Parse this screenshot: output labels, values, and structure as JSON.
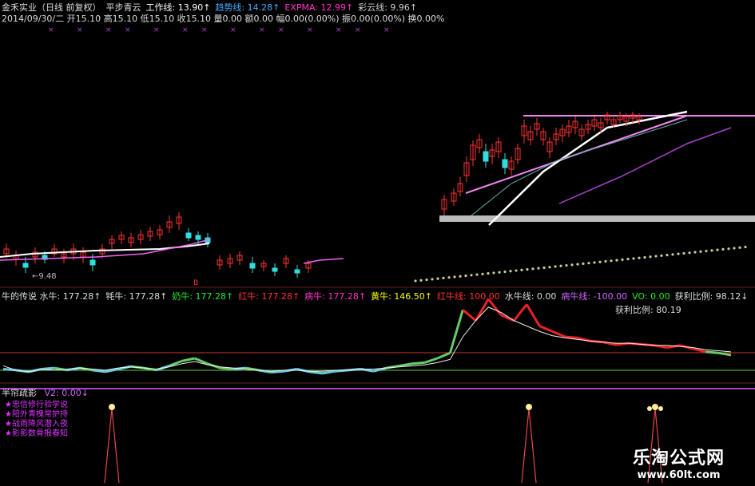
{
  "header": {
    "title_line": [
      {
        "text": "金禾实业（日线 前复权）",
        "color": "#dddddd"
      },
      {
        "text": "平步青云",
        "color": "#dddddd"
      },
      {
        "text": "工作线: 13.90↑",
        "color": "#ffffff"
      },
      {
        "text": "趋势线: 14.28↑",
        "color": "#44aaff"
      },
      {
        "text": "EXPMA: 12.99↑",
        "color": "#ff33cc"
      },
      {
        "text": "彩云线: 9.96↑",
        "color": "#cccccc"
      }
    ],
    "info_line": "2014/09/30/二 开15.10 高15.10 低15.10 收15.10 量0.00 额0.00 幅0.00(0.00%) 振0.00(0.00%) 换0.00%"
  },
  "main_chart": {
    "low_label": "←9.48",
    "marker_text": "B"
  },
  "indicator1": {
    "values": [
      {
        "text": "牛的传说 水牛: 177.28↑",
        "color": "#dddddd"
      },
      {
        "text": "牦牛: 177.28↑",
        "color": "#dddddd"
      },
      {
        "text": "奶牛: 177.28↑",
        "color": "#22ee22"
      },
      {
        "text": "红牛: 177.28↑",
        "color": "#ff3333"
      },
      {
        "text": "病牛: 177.28↑",
        "color": "#ff33cc"
      },
      {
        "text": "黄牛: 146.50↑",
        "color": "#ffff00"
      },
      {
        "text": "红牛线: 100.00",
        "color": "#ff3333"
      },
      {
        "text": "水牛线: 0.00",
        "color": "#dddddd"
      },
      {
        "text": "病牛线: -100.00",
        "color": "#cc66ff"
      },
      {
        "text": "VO: 0.00",
        "color": "#22ee22"
      },
      {
        "text": "获利比例: 98.12↓",
        "color": "#dddddd"
      }
    ],
    "ratio2": "获利比例: 80.19"
  },
  "indicator2": {
    "label": "半帘疏影",
    "v2": "V2: 0.00↓",
    "notes": [
      "★忠信修行验学说",
      "★阳外青槐常护持",
      "★战雨降风潜入夜",
      "★影影数骨报春知"
    ]
  },
  "watermark": {
    "line1": "乐淘公式网",
    "line2": "www.60lt.com"
  },
  "colors": {
    "up": "#ff3333",
    "down": "#33dddd",
    "bg": "#000000",
    "pink": "#ee88ee"
  },
  "chart_data": {
    "type": "line",
    "title": "金禾实业",
    "series": [
      {
        "name": "水牛",
        "values": [
          60,
          58,
          55,
          60,
          62,
          58,
          62,
          58,
          55,
          60,
          65,
          62,
          58,
          66,
          75,
          80,
          70,
          62,
          60,
          62,
          58,
          54,
          56,
          60,
          55,
          52,
          56,
          58,
          60,
          56,
          62,
          66,
          70,
          72,
          80,
          90,
          170,
          150,
          190,
          160,
          150,
          180,
          140,
          130,
          120,
          118,
          112,
          110,
          105,
          108,
          106,
          104,
          100,
          104,
          98,
          92,
          90,
          86
        ]
      },
      {
        "name": "获利比例",
        "values": [
          66,
          58,
          55,
          60,
          58,
          60,
          62,
          60,
          58,
          62,
          64,
          62,
          60,
          64,
          70,
          74,
          68,
          64,
          62,
          60,
          58,
          56,
          58,
          58,
          56,
          56,
          58,
          58,
          60,
          60,
          62,
          64,
          66,
          68,
          72,
          78,
          120,
          150,
          175,
          165,
          150,
          140,
          130,
          122,
          118,
          115,
          112,
          110,
          108,
          108,
          106,
          104,
          104,
          102,
          100,
          96,
          94,
          92
        ]
      }
    ]
  }
}
